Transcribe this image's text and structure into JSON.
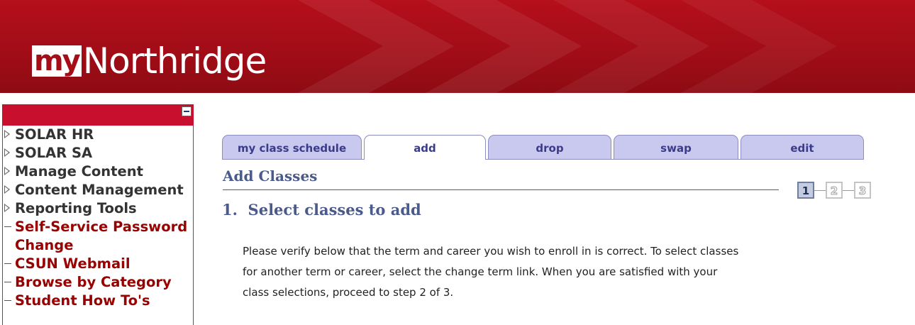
{
  "header": {
    "logo_my": "my",
    "logo_northridge": "Northridge"
  },
  "menu": {
    "items": [
      {
        "label": "SOLAR HR",
        "type": "folder"
      },
      {
        "label": "SOLAR SA",
        "type": "folder"
      },
      {
        "label": "Manage Content",
        "type": "folder"
      },
      {
        "label": "Content Management",
        "type": "folder"
      },
      {
        "label": "Reporting Tools",
        "type": "folder"
      },
      {
        "label": "Self-Service Password",
        "label2": "Change",
        "type": "link"
      },
      {
        "label": "CSUN Webmail",
        "type": "link"
      },
      {
        "label": "Browse by Category",
        "type": "link"
      },
      {
        "label": "Student How To's",
        "type": "link"
      }
    ]
  },
  "tabs": [
    {
      "label": "my class schedule"
    },
    {
      "label": "add",
      "active": true
    },
    {
      "label": "drop"
    },
    {
      "label": "swap"
    },
    {
      "label": "edit"
    }
  ],
  "main": {
    "title": "Add Classes",
    "steps": {
      "current": 1,
      "total": 3,
      "labels": [
        "1",
        "2",
        "3"
      ]
    },
    "step_heading": "1.  Select classes to add",
    "instructions": "Please verify below that the term and career you wish to enroll in is correct.  To select classes\nfor another term or career, select the change term link.  When you are satisfied with your\nclass selections, proceed to step 2 of 3."
  },
  "colors": {
    "banner": "#a50d17",
    "menu_header": "#c8102e",
    "link": "#990000",
    "tab_fill": "#c9c9f0",
    "heading": "#4a5a8a"
  }
}
